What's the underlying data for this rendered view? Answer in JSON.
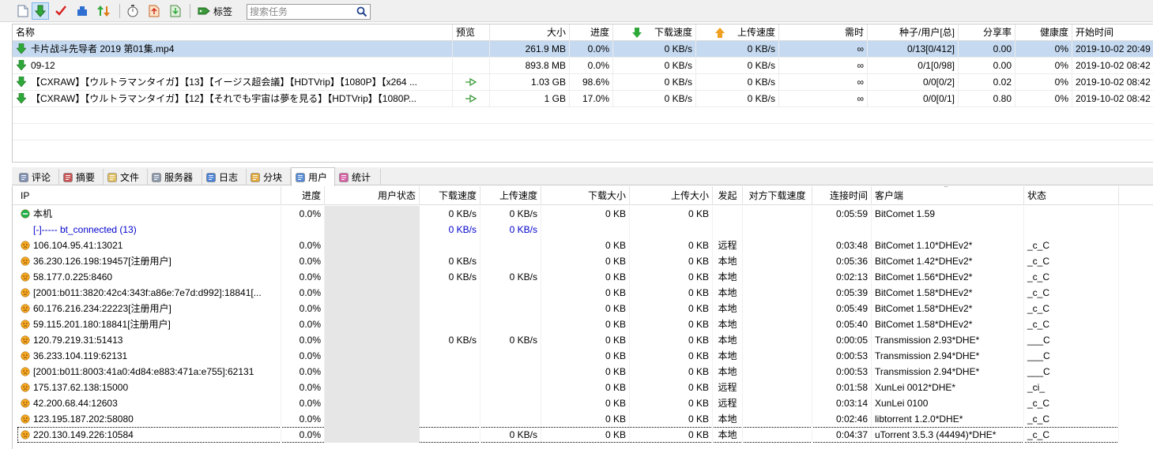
{
  "toolbar": {
    "tag_label": "标签",
    "search_placeholder": "搜索任务"
  },
  "tasks": {
    "headers": {
      "name": "名称",
      "preview": "预览",
      "size": "大小",
      "progress": "进度",
      "down_speed": "下载速度",
      "up_speed": "上传速度",
      "eta": "需时",
      "seeds": "种子/用户[总]",
      "ratio": "分享率",
      "health": "健康度",
      "start_time": "开始时间"
    },
    "rows": [
      {
        "name": "卡片战斗先导者 2019 第01集.mp4",
        "size": "261.9 MB",
        "progress": "0.0%",
        "down": "0 KB/s",
        "up": "0 KB/s",
        "eta": "∞",
        "seeds": "0/13[0/412]",
        "ratio": "0.00",
        "health": "0%",
        "start": "2019-10-02 20:49",
        "selected": true,
        "preview": false
      },
      {
        "name": "09-12",
        "size": "893.8 MB",
        "progress": "0.0%",
        "down": "0 KB/s",
        "up": "0 KB/s",
        "eta": "∞",
        "seeds": "0/1[0/98]",
        "ratio": "0.00",
        "health": "0%",
        "start": "2019-10-02 08:42",
        "selected": false,
        "preview": false
      },
      {
        "name": "【CXRAW】【ウルトラマンタイガ】【13】【イージス超会議】【HDTVrip】【1080P】【x264 ...",
        "size": "1.03 GB",
        "progress": "98.6%",
        "down": "0 KB/s",
        "up": "0 KB/s",
        "eta": "∞",
        "seeds": "0/0[0/2]",
        "ratio": "0.02",
        "health": "0%",
        "start": "2019-10-02 08:42",
        "selected": false,
        "preview": true
      },
      {
        "name": "【CXRAW】【ウルトラマンタイガ】【12】【それでも宇宙は夢を見る】【HDTVrip】【1080P...",
        "size": "1 GB",
        "progress": "17.0%",
        "down": "0 KB/s",
        "up": "0 KB/s",
        "eta": "∞",
        "seeds": "0/0[0/1]",
        "ratio": "0.80",
        "health": "0%",
        "start": "2019-10-02 08:42",
        "selected": false,
        "preview": true
      }
    ]
  },
  "tabs": [
    {
      "label": "评论",
      "icon": "comment-icon"
    },
    {
      "label": "摘要",
      "icon": "summary-icon"
    },
    {
      "label": "文件",
      "icon": "files-icon"
    },
    {
      "label": "服务器",
      "icon": "server-icon"
    },
    {
      "label": "日志",
      "icon": "log-icon"
    },
    {
      "label": "分块",
      "icon": "pieces-icon"
    },
    {
      "label": "用户",
      "icon": "peers-icon",
      "active": true
    },
    {
      "label": "统计",
      "icon": "stats-icon"
    }
  ],
  "peers": {
    "headers": {
      "ip": "IP",
      "progress": "进度",
      "user_state": "用户状态",
      "down_speed": "下载速度",
      "up_speed": "上传速度",
      "down_size": "下载大小",
      "up_size": "上传大小",
      "initiator": "发起",
      "remote_down_speed": "对方下载速度",
      "conn_time": "连接时间",
      "client": "客户端",
      "status": "状态"
    },
    "rows": [
      {
        "ip": "本机",
        "icon": "green",
        "progress": "0.0%",
        "down": "0 KB/s",
        "up": "0 KB/s",
        "dsize": "0 KB",
        "usize": "0 KB",
        "init": "",
        "remote": "",
        "time": "0:05:59",
        "client": "BitComet 1.59",
        "status": ""
      },
      {
        "ip": "[-]----- bt_connected (13)",
        "icon": "",
        "progress": "",
        "down": "0 KB/s",
        "up": "0 KB/s",
        "dsize": "",
        "usize": "",
        "init": "",
        "remote": "",
        "time": "",
        "client": "",
        "status": "",
        "group": true
      },
      {
        "ip": "106.104.95.41:13021",
        "icon": "orange",
        "progress": "0.0%",
        "down": "",
        "up": "",
        "dsize": "0 KB",
        "usize": "0 KB",
        "init": "远程",
        "remote": "",
        "time": "0:03:48",
        "client": "BitComet 1.10*DHEv2*",
        "status": "_c_C"
      },
      {
        "ip": "36.230.126.198:19457[注册用户]",
        "icon": "orange",
        "progress": "0.0%",
        "down": "0 KB/s",
        "up": "",
        "dsize": "0 KB",
        "usize": "0 KB",
        "init": "本地",
        "remote": "",
        "time": "0:05:36",
        "client": "BitComet 1.42*DHEv2*",
        "status": "_c_C"
      },
      {
        "ip": "58.177.0.225:8460",
        "icon": "orange",
        "progress": "0.0%",
        "down": "0 KB/s",
        "up": "0 KB/s",
        "dsize": "0 KB",
        "usize": "0 KB",
        "init": "本地",
        "remote": "",
        "time": "0:02:13",
        "client": "BitComet 1.56*DHEv2*",
        "status": "_c_C"
      },
      {
        "ip": "[2001:b011:3820:42c4:343f:a86e:7e7d:d992]:18841[...",
        "icon": "orange",
        "progress": "0.0%",
        "down": "",
        "up": "",
        "dsize": "0 KB",
        "usize": "0 KB",
        "init": "本地",
        "remote": "",
        "time": "0:05:39",
        "client": "BitComet 1.58*DHEv2*",
        "status": "_c_C"
      },
      {
        "ip": "60.176.216.234:22223[注册用户]",
        "icon": "orange",
        "progress": "0.0%",
        "down": "",
        "up": "",
        "dsize": "0 KB",
        "usize": "0 KB",
        "init": "本地",
        "remote": "",
        "time": "0:05:49",
        "client": "BitComet 1.58*DHEv2*",
        "status": "_c_C"
      },
      {
        "ip": "59.115.201.180:18841[注册用户]",
        "icon": "orange",
        "progress": "0.0%",
        "down": "",
        "up": "",
        "dsize": "0 KB",
        "usize": "0 KB",
        "init": "本地",
        "remote": "",
        "time": "0:05:40",
        "client": "BitComet 1.58*DHEv2*",
        "status": "_c_C"
      },
      {
        "ip": "120.79.219.31:51413",
        "icon": "orange",
        "progress": "0.0%",
        "down": "0 KB/s",
        "up": "0 KB/s",
        "dsize": "0 KB",
        "usize": "0 KB",
        "init": "本地",
        "remote": "",
        "time": "0:00:05",
        "client": "Transmission 2.93*DHE*",
        "status": "___C"
      },
      {
        "ip": "36.233.104.119:62131",
        "icon": "orange",
        "progress": "0.0%",
        "down": "",
        "up": "",
        "dsize": "0 KB",
        "usize": "0 KB",
        "init": "本地",
        "remote": "",
        "time": "0:00:53",
        "client": "Transmission 2.94*DHE*",
        "status": "___C"
      },
      {
        "ip": "[2001:b011:8003:41a0:4d84:e883:471a:e755]:62131",
        "icon": "orange",
        "progress": "0.0%",
        "down": "",
        "up": "",
        "dsize": "0 KB",
        "usize": "0 KB",
        "init": "本地",
        "remote": "",
        "time": "0:00:53",
        "client": "Transmission 2.94*DHE*",
        "status": "___C"
      },
      {
        "ip": "175.137.62.138:15000",
        "icon": "orange",
        "progress": "0.0%",
        "down": "",
        "up": "",
        "dsize": "0 KB",
        "usize": "0 KB",
        "init": "远程",
        "remote": "",
        "time": "0:01:58",
        "client": "XunLei 0012*DHE*",
        "status": "_ci_"
      },
      {
        "ip": "42.200.68.44:12603",
        "icon": "orange",
        "progress": "0.0%",
        "down": "",
        "up": "",
        "dsize": "0 KB",
        "usize": "0 KB",
        "init": "远程",
        "remote": "",
        "time": "0:03:14",
        "client": "XunLei 0100",
        "status": "_c_C"
      },
      {
        "ip": "123.195.187.202:58080",
        "icon": "orange",
        "progress": "0.0%",
        "down": "",
        "up": "",
        "dsize": "0 KB",
        "usize": "0 KB",
        "init": "本地",
        "remote": "",
        "time": "0:02:46",
        "client": "libtorrent 1.2.0*DHE*",
        "status": "_c_C"
      },
      {
        "ip": "220.130.149.226:10584",
        "icon": "orange",
        "progress": "0.0%",
        "down": "",
        "up": "0 KB/s",
        "dsize": "0 KB",
        "usize": "0 KB",
        "init": "本地",
        "remote": "",
        "time": "0:04:37",
        "client": "uTorrent 3.5.3 (44494)*DHE*",
        "status": "_c_C",
        "focused": true
      }
    ]
  }
}
